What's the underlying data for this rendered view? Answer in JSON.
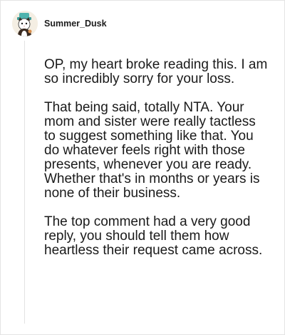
{
  "comment": {
    "author": "Summer_Dusk",
    "avatar_icon": "cat-avatar-icon",
    "paragraphs": [
      "OP, my heart broke reading this. I am so incredibly sorry for your loss.",
      "That being said, totally NTA. Your mom and sister were really tactless to suggest something like that. You do whatever feels right with those presents, whenever you are ready. Whether that's in months or years is none of their business.",
      "The top comment had a very good reply, you should tell them how heartless their request came across."
    ]
  },
  "colors": {
    "background": "#ffffff",
    "text": "#1a1a1a",
    "thread_line": "#e2e2e2"
  }
}
